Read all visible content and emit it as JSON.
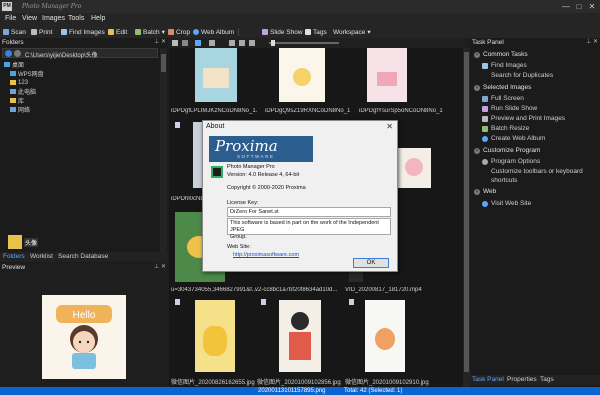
{
  "app": {
    "title": "Photo Manager Pro",
    "icon_text": "PM"
  },
  "window_controls": [
    "—",
    "□",
    "✕"
  ],
  "menu": [
    "File",
    "View",
    "Images",
    "Tools",
    "Help"
  ],
  "toolbar": {
    "scan": "Scan",
    "print": "Print",
    "find_images": "Find Images",
    "edit": "Edit",
    "batch": "Batch",
    "crop": "Crop",
    "web_album": "Web Album",
    "slide_show": "Slide Show",
    "tags": "Tags",
    "workspace": "Workspace"
  },
  "folders": {
    "title": "Folders",
    "path": "C:\\Users\\yijie\\Desktop\\头像",
    "tree": [
      "桌面",
      "WPS网盘",
      "123",
      "此电脑",
      "库",
      "网络"
    ],
    "selected_folder": "头像",
    "tabs": [
      "Folders",
      "Worklist",
      "Search Database"
    ]
  },
  "preview": {
    "title": "Preview",
    "image_text": "Hello"
  },
  "thumbnails": {
    "row1_labels": [
      "iDPDgfLPLIMJKzNCoDN8No_1.",
      "iDPDgQ9sZ19RXNCoDN8No_1",
      "iDPDgfYsurSp5oNCoDN8No_1"
    ],
    "row2_label": "iDPDhl0cN8",
    "row3_labels": [
      "u=3043734055,3466827991&f...",
      "v2-cc8bc1a7bf20f8634ad10d...",
      "VID_20200817_181720.mp4"
    ],
    "row4_labels": [
      "微信图片_20200826162655.jpg",
      "微信图片_20201009102856.jpg",
      "微信图片_20201009102910.jpg"
    ]
  },
  "task_panel": {
    "title": "Task Panel",
    "sections": [
      {
        "label": "Common Tasks",
        "items": [
          "Find Images",
          "Search for Duplicates"
        ]
      },
      {
        "label": "Selected Images",
        "items": [
          "Full Screen",
          "Run Slide Show",
          "Preview and Print Images",
          "Batch Resize",
          "Create Web Album"
        ]
      },
      {
        "label": "Customize Program",
        "items": [
          "Program Options",
          "Customize toolbars or keyboard",
          "shortcuts"
        ]
      },
      {
        "label": "Web",
        "items": [
          "Visit Web Site"
        ]
      }
    ],
    "tabs": [
      "Task Panel",
      "Properties",
      "Tags"
    ]
  },
  "statusbar": {
    "file": "20200113101157895.png",
    "total": "Total: 42 (Selected: 1)"
  },
  "about": {
    "title": "About",
    "logo": "Proxima",
    "logo_sub": "SOFTWARE",
    "product": "Photo Manager Pro",
    "version": "Version: 4.0 Release 4, 64-bit",
    "copyright": "Copyright © 2000-2020 Proxima",
    "license_label": "License Key:",
    "license_value": "DrZero For Sanet.st",
    "jpeg_note_1": "This software is based in part on the work of the Independent JPEG",
    "jpeg_note_2": "Group.",
    "website_label": "Web Site:",
    "website_url": "http://proximasoftware.com",
    "ok": "OK"
  },
  "colors": {
    "status_bar": "#0a64d2",
    "accent": "#5aa7ff",
    "dialog_bg": "#f0f0f0"
  }
}
